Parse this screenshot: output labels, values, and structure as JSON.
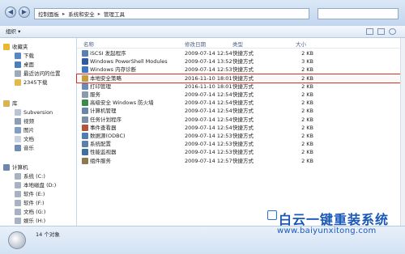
{
  "window": {
    "minimize": "—",
    "maximize": "□",
    "close": "✕"
  },
  "address": {
    "back": "◀",
    "forward": "▶",
    "path": [
      "控制面板",
      "系统和安全",
      "管理工具"
    ],
    "separator": "▸",
    "search_placeholder": ""
  },
  "toolbar": {
    "organize": "组织 ▾"
  },
  "sidebar": {
    "favorites_header": "收藏夹",
    "favorites": [
      "下载",
      "桌面",
      "最近访问的位置",
      "2345下载"
    ],
    "libraries_header": "库",
    "libraries": [
      "Subversion",
      "视频",
      "图片",
      "文档",
      "音乐"
    ],
    "computer_header": "计算机",
    "drives": [
      "系统 (C:)",
      "本地磁盘 (D:)",
      "软件 (E:)",
      "软件 (F:)",
      "文档 (G:)",
      "娱乐 (H:)"
    ]
  },
  "columns": {
    "name": "名称",
    "date": "修改日期",
    "type": "类型",
    "size": "大小"
  },
  "files": [
    {
      "name": "iSCSI 发起程序",
      "date": "2009-07-14 12:54",
      "type": "快捷方式",
      "size": "2 KB",
      "icon": "#5a7fb5"
    },
    {
      "name": "Windows PowerShell Modules",
      "date": "2009-07-14 13:52",
      "type": "快捷方式",
      "size": "3 KB",
      "icon": "#2d5aa0"
    },
    {
      "name": "Windows 内存诊断",
      "date": "2009-07-14 12:53",
      "type": "快捷方式",
      "size": "2 KB",
      "icon": "#3e77c2"
    },
    {
      "name": "本地安全策略",
      "date": "2016-11-10 18:01",
      "type": "快捷方式",
      "size": "2 KB",
      "icon": "#c99b3a"
    },
    {
      "name": "打印管理",
      "date": "2016-11-10 18:01",
      "type": "快捷方式",
      "size": "2 KB",
      "icon": "#6a8cb8"
    },
    {
      "name": "服务",
      "date": "2009-07-14 12:54",
      "type": "快捷方式",
      "size": "2 KB",
      "icon": "#8a9bb0"
    },
    {
      "name": "高级安全 Windows 防火墙",
      "date": "2009-07-14 12:54",
      "type": "快捷方式",
      "size": "2 KB",
      "icon": "#3a8a4a"
    },
    {
      "name": "计算机管理",
      "date": "2009-07-14 12:54",
      "type": "快捷方式",
      "size": "2 KB",
      "icon": "#6b86a8"
    },
    {
      "name": "任务计划程序",
      "date": "2009-07-14 12:54",
      "type": "快捷方式",
      "size": "2 KB",
      "icon": "#7c8fa6"
    },
    {
      "name": "事件查看器",
      "date": "2009-07-14 12:54",
      "type": "快捷方式",
      "size": "2 KB",
      "icon": "#b3543c"
    },
    {
      "name": "数据源(ODBC)",
      "date": "2009-07-14 12:53",
      "type": "快捷方式",
      "size": "2 KB",
      "icon": "#4f7db3"
    },
    {
      "name": "系统配置",
      "date": "2009-07-14 12:53",
      "type": "快捷方式",
      "size": "2 KB",
      "icon": "#5d7fa8"
    },
    {
      "name": "性能监视器",
      "date": "2009-07-14 12:53",
      "type": "快捷方式",
      "size": "2 KB",
      "icon": "#3e6f9e"
    },
    {
      "name": "组件服务",
      "date": "2009-07-14 12:57",
      "type": "快捷方式",
      "size": "2 KB",
      "icon": "#8c7a4e"
    }
  ],
  "status": {
    "count": "14 个对象"
  },
  "watermark": {
    "title": "白云一键重装系统",
    "url": "www.baiyunxitong.com"
  }
}
